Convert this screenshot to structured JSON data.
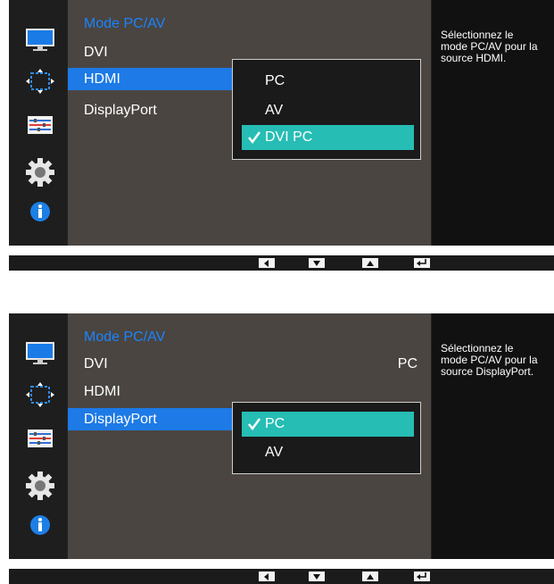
{
  "screens": [
    {
      "menu": {
        "title": "Mode PC/AV",
        "items": [
          {
            "label": "DVI",
            "value": ""
          },
          {
            "label": "HDMI",
            "value": ""
          },
          {
            "label": "DisplayPort",
            "value": ""
          }
        ],
        "selected_item": "HDMI"
      },
      "submenu": {
        "options": [
          "PC",
          "AV",
          "DVI PC"
        ],
        "selected_option": "DVI PC"
      },
      "help": {
        "line1": "Sélectionnez le",
        "line2": "mode PC/AV pour la",
        "line3": "source HDMI."
      }
    },
    {
      "menu": {
        "title": "Mode PC/AV",
        "items": [
          {
            "label": "DVI",
            "value": "PC"
          },
          {
            "label": "HDMI",
            "value": ""
          },
          {
            "label": "DisplayPort",
            "value": ""
          }
        ],
        "selected_item": "DisplayPort"
      },
      "submenu": {
        "options": [
          "PC",
          "AV"
        ],
        "selected_option": "PC"
      },
      "help": {
        "line1": "Sélectionnez le",
        "line2": "mode PC/AV pour la",
        "line3": "source DisplayPort."
      }
    }
  ],
  "sidebar_icons": [
    "monitor-icon",
    "size-position-icon",
    "setup-icon",
    "gear-icon",
    "info-icon"
  ],
  "nav_buttons": [
    "left-arrow-icon",
    "down-arrow-icon",
    "up-arrow-icon",
    "enter-icon"
  ],
  "colors": {
    "title_blue": "#1a84ff",
    "selected_item_blue": "#1d7ae6",
    "selected_option_teal": "#26bdb4",
    "panel_brown": "#4a4541"
  }
}
